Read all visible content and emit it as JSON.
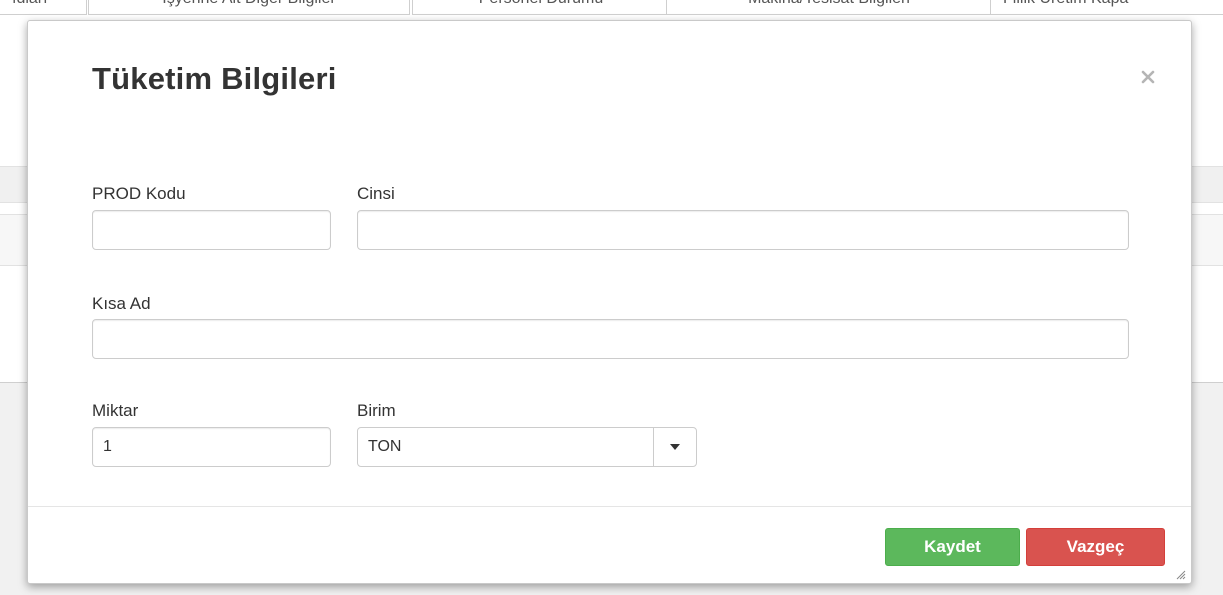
{
  "background": {
    "tabs": [
      "ıdları",
      "İşyerine Ait Diğer Bilgiler",
      "Personel Durumu",
      "Makina/Tesisat Bilgileri",
      "Fiilik Üretim Kapa"
    ]
  },
  "modal": {
    "title": "Tüketim Bilgileri",
    "close_icon": "close-icon",
    "fields": {
      "prod_kodu": {
        "label": "PROD Kodu",
        "value": ""
      },
      "cinsi": {
        "label": "Cinsi",
        "value": ""
      },
      "kisa_ad": {
        "label": "Kısa Ad",
        "value": ""
      },
      "miktar": {
        "label": "Miktar",
        "value": "1"
      },
      "birim": {
        "label": "Birim",
        "value": "TON"
      }
    },
    "buttons": {
      "save": "Kaydet",
      "cancel": "Vazgeç"
    }
  },
  "colors": {
    "save": "#5cb85c",
    "cancel": "#d9534f"
  }
}
